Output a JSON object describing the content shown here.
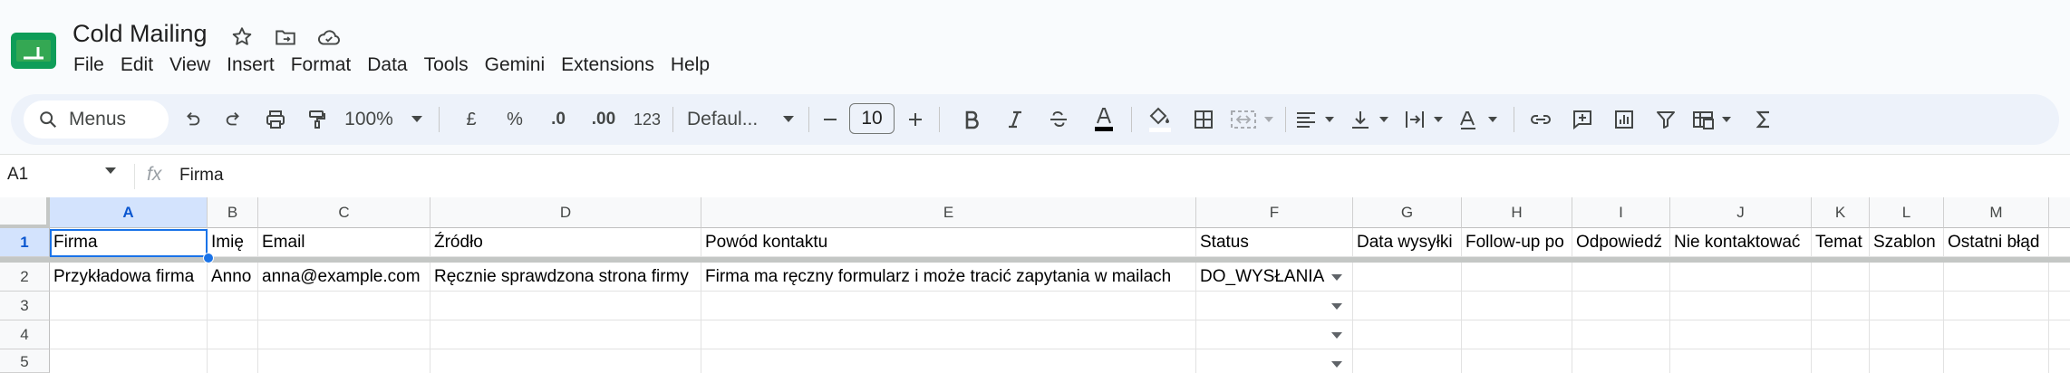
{
  "document": {
    "title": "Cold Mailing"
  },
  "menu": [
    "File",
    "Edit",
    "View",
    "Insert",
    "Format",
    "Data",
    "Tools",
    "Gemini",
    "Extensions",
    "Help"
  ],
  "toolbar": {
    "search_label": "Menus",
    "zoom": "100%",
    "currency": "£",
    "percent": "%",
    "decrease_decimal": ".0",
    "increase_decimal": ".00",
    "number_format": "123",
    "font": "Defaul...",
    "font_size": "10",
    "text_color": "#000000"
  },
  "formula_bar": {
    "cell_ref": "A1",
    "fx": "fx",
    "content": "Firma"
  },
  "columns": [
    "A",
    "B",
    "C",
    "D",
    "E",
    "F",
    "G",
    "H",
    "I",
    "J",
    "K",
    "L",
    "M"
  ],
  "rows": [
    "1",
    "2",
    "3",
    "4",
    "5"
  ],
  "cells": {
    "row1": [
      "Firma",
      "Imię",
      "Email",
      "Źródło",
      "Powód kontaktu",
      "Status",
      "Data wysyłki",
      "Follow-up po",
      "Odpowiedź",
      "Nie kontaktować",
      "Temat",
      "Szablon",
      "Ostatni błąd"
    ],
    "row2": [
      "Przykładowa firma",
      "Anno",
      "anna@example.com",
      "Ręcznie sprawdzona strona firmy",
      "Firma ma ręczny formularz i może tracić zapytania w mailach",
      "DO_WYSŁANIA",
      "",
      "",
      "",
      "",
      "",
      "",
      ""
    ]
  },
  "selection": {
    "active_cell": "A1",
    "color": "#1a73e8"
  }
}
